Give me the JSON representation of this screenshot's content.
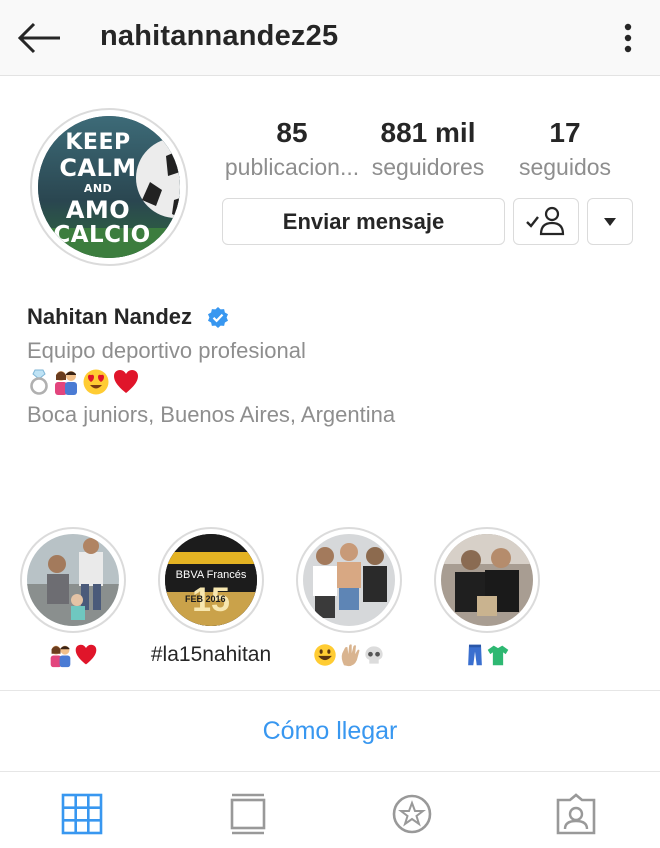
{
  "header": {
    "username": "nahitannandez25"
  },
  "avatar": {
    "line1": "KEEP",
    "line2": "CALM",
    "line3": "AND",
    "line4": "AMO",
    "line5": "CALCIO"
  },
  "stats": {
    "posts_count": "85",
    "posts_label": "publicacion...",
    "followers_count": "881 mil",
    "followers_label": "seguidores",
    "following_count": "17",
    "following_label": "seguidos"
  },
  "actions": {
    "message_label": "Enviar mensaje"
  },
  "bio": {
    "name": "Nahitan Nandez",
    "category": "Equipo deportivo profesional",
    "emoji_icons": [
      "ring-emoji",
      "couple-emoji",
      "heart-eyes-emoji",
      "red-heart-emoji"
    ],
    "location": "Boca juniors, Buenos Aires, Argentina"
  },
  "highlights": [
    {
      "label": "",
      "emoji_icons": [
        "couple-emoji",
        "red-heart-emoji"
      ]
    },
    {
      "label": "#la15nahitan",
      "sign_text": "BBVA Francés",
      "number": "15",
      "date": "FEB 2016"
    },
    {
      "label": "",
      "emoji_icons": [
        "grinning-emoji",
        "wave-hand-emoji",
        "skull-emoji"
      ]
    },
    {
      "label": "",
      "emoji_icons": [
        "jeans-emoji",
        "shirt-emoji"
      ]
    }
  ],
  "directions": {
    "label": "Cómo llegar"
  },
  "tabs": {
    "active": "grid",
    "items": [
      "grid-icon",
      "feed-icon",
      "saved-icon",
      "tagged-icon"
    ]
  },
  "colors": {
    "link_blue": "#3897f0",
    "verified_blue": "#3897f0",
    "heart_red": "#e0152a",
    "secondary_text": "#8e8e8e"
  }
}
